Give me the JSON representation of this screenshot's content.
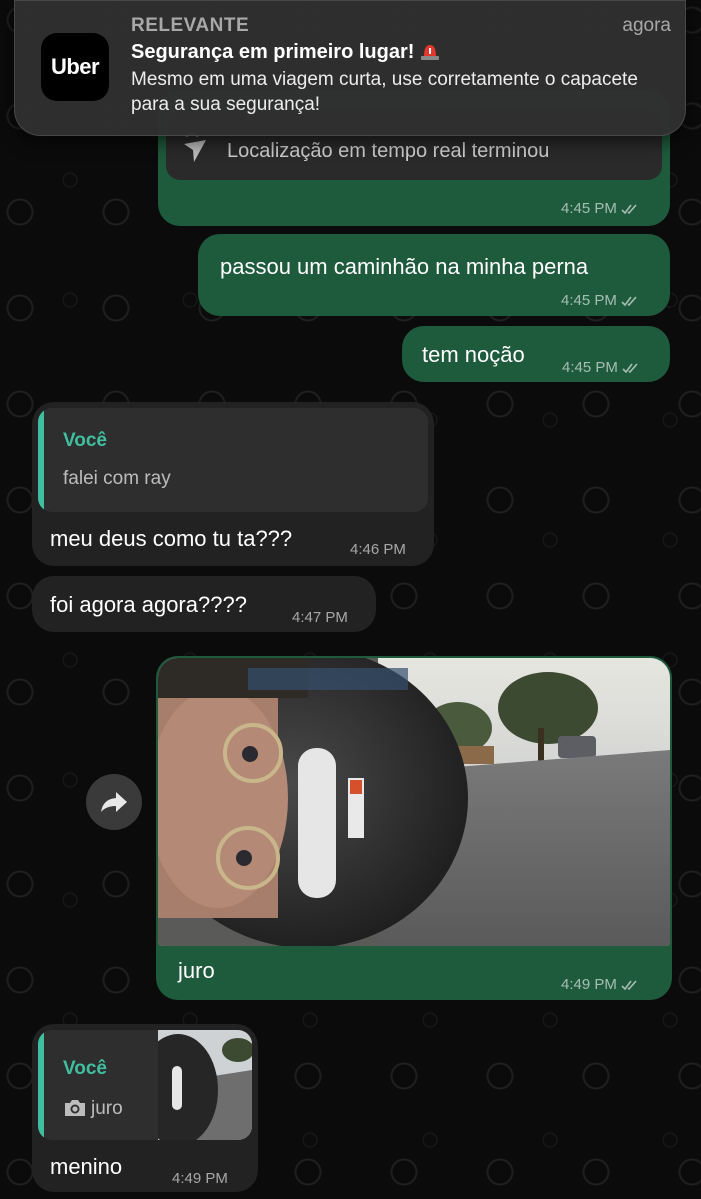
{
  "notification": {
    "app_label": "RELEVANTE",
    "time": "agora",
    "logo_text": "Uber",
    "title": "Segurança em primeiro lugar!",
    "body": "Mesmo em uma viagem curta, use corretamente o capacete para a sua segurança!"
  },
  "messages": {
    "location": {
      "text": "Localização em tempo real terminou",
      "time": "4:45 PM"
    },
    "out1": {
      "text": "passou um caminhão na minha perna",
      "time": "4:45 PM"
    },
    "out2": {
      "text": "tem noção",
      "time": "4:45 PM"
    },
    "in1": {
      "quote_author": "Você",
      "quote_text": "falei com ray",
      "text": "meu deus como tu ta???",
      "time": "4:46 PM"
    },
    "in2": {
      "text": "foi agora agora????",
      "time": "4:47 PM"
    },
    "photo_msg": {
      "caption": "juro",
      "time": "4:49 PM"
    },
    "in3": {
      "quote_author": "Você",
      "quote_text": "juro",
      "text": "menino",
      "time": "4:49 PM"
    }
  },
  "colors": {
    "outgoing_bubble": "#1e5a3c",
    "incoming_bubble": "#222222",
    "quote_accent": "#3fbfa0",
    "wallpaper": "#0b0b0b"
  },
  "icons": [
    "uber-logo",
    "siren-icon",
    "live-location-icon",
    "double-check-icon",
    "forward-icon",
    "camera-icon"
  ]
}
